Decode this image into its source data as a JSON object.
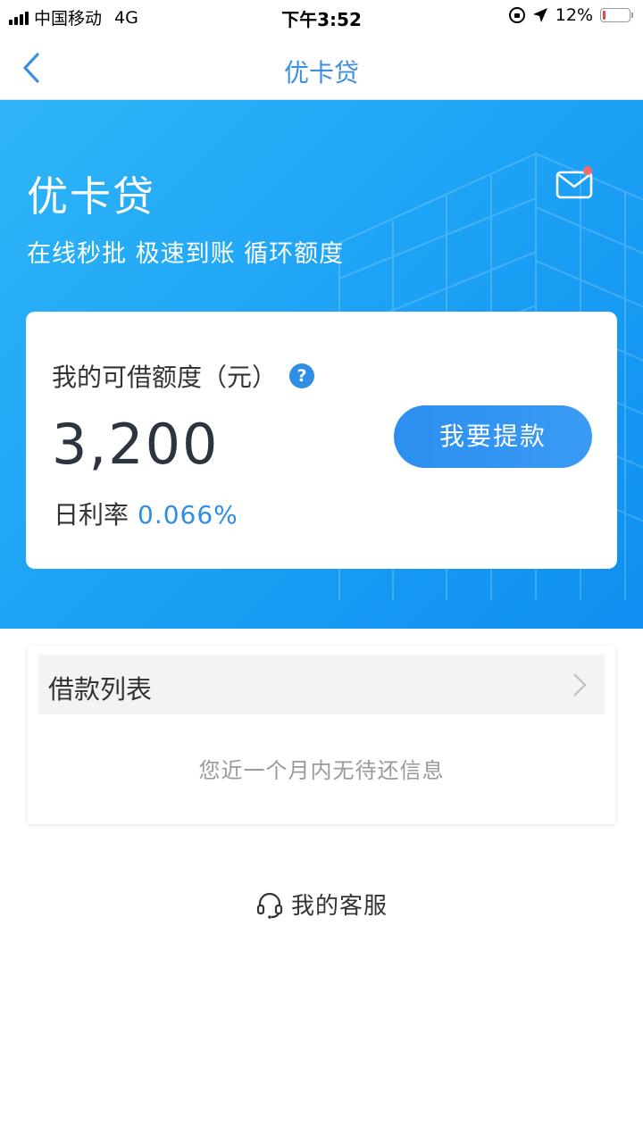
{
  "status_bar": {
    "carrier": "中国移动",
    "network": "4G",
    "time": "下午3:52",
    "battery_percent": "12%",
    "battery_level": 0.12,
    "icons": [
      "signal-icon",
      "rotation-lock-icon",
      "location-icon",
      "battery-icon"
    ]
  },
  "nav": {
    "title": "优卡贷",
    "back_icon": "chevron-left-icon"
  },
  "hero": {
    "title": "优卡贷",
    "subtitle": "在线秒批 极速到账 循环额度",
    "mail_icon": "mail-icon",
    "has_notification": true
  },
  "credit": {
    "label": "我的可借额度（元）",
    "help_icon_text": "?",
    "amount": "3,200",
    "rate_label": "日利率",
    "rate_value": "0.066%",
    "withdraw_button": "我要提款"
  },
  "loans": {
    "title": "借款列表",
    "empty_text": "您近一个月内无待还信息"
  },
  "service": {
    "label": "我的客服",
    "icon": "headset-icon"
  },
  "colors": {
    "accent": "#2f8de4",
    "hero_gradient_start": "#2fb5f7",
    "hero_gradient_end": "#0f8ff0",
    "notification_dot": "#f26b6b"
  }
}
